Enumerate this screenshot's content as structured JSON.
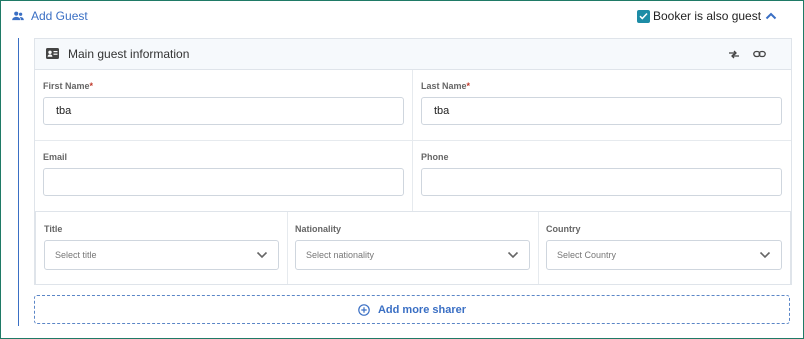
{
  "header": {
    "add_guest_label": "Add Guest",
    "booker_checkbox_label": "Booker is also guest",
    "booker_checked": true
  },
  "card": {
    "title": "Main guest information",
    "fields": {
      "first_name": {
        "label": "First Name",
        "required_mark": "*",
        "value": "tba"
      },
      "last_name": {
        "label": "Last Name",
        "required_mark": "*",
        "value": "tba"
      },
      "email": {
        "label": "Email",
        "value": ""
      },
      "phone": {
        "label": "Phone",
        "value": ""
      }
    },
    "selects": {
      "title": {
        "label": "Title",
        "placeholder": "Select title"
      },
      "nationality": {
        "label": "Nationality",
        "placeholder": "Select nationality"
      },
      "country": {
        "label": "Country",
        "placeholder": "Select Country"
      }
    }
  },
  "footer": {
    "add_more_label": "Add more sharer"
  },
  "colors": {
    "frame_border": "#1f7a66",
    "accent": "#3a6fc4",
    "checkbox": "#1d8ca6",
    "required": "#c0392b"
  }
}
